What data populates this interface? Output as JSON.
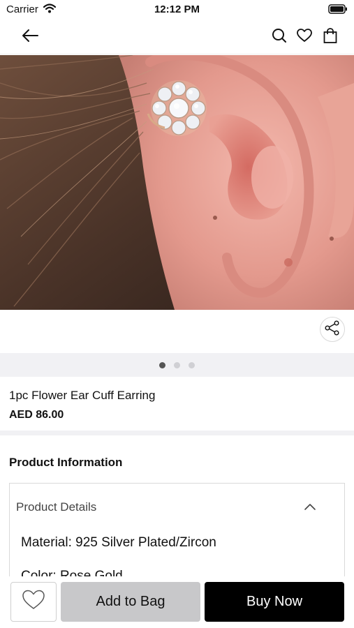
{
  "status_bar": {
    "carrier": "Carrier",
    "time": "12:12 PM"
  },
  "nav": {
    "back_icon": "arrow-left-icon",
    "search_icon": "search-icon",
    "wishlist_icon": "heart-icon",
    "bag_icon": "shopping-bag-icon"
  },
  "gallery": {
    "image_description_icon": "product-photo",
    "page_count": 3,
    "active_page": 1
  },
  "product": {
    "title": "1pc Flower Ear Cuff Earring",
    "price": "AED 86.00"
  },
  "product_info": {
    "heading": "Product Information",
    "details_header": "Product Details",
    "details_lines": [
      "Material: 925 Silver Plated/Zircon",
      "Color: Rose Gold"
    ]
  },
  "actions": {
    "add_to_bag_label": "Add to Bag",
    "buy_now_label": "Buy Now"
  },
  "colors": {
    "accent": "#000000",
    "secondary_button": "#c8c8ca",
    "divider": "#f1f1f4"
  }
}
